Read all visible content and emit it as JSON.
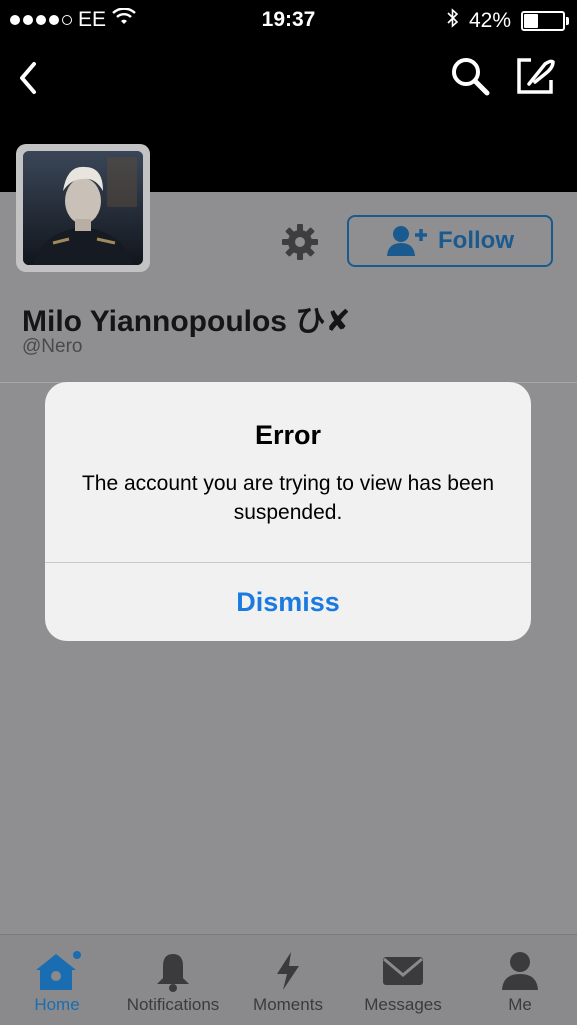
{
  "status_bar": {
    "carrier": "EE",
    "time": "19:37",
    "battery": "42%",
    "battery_level": 0.42
  },
  "navbar": {
    "back_icon": "chevron-left-icon",
    "search_icon": "search-icon",
    "compose_icon": "compose-icon"
  },
  "profile": {
    "name": "Milo Yiannopoulos ひ✘",
    "handle": "@Nero",
    "follow_label": "Follow"
  },
  "alert": {
    "title": "Error",
    "message": "The account you are trying to view has been suspended.",
    "dismiss_label": "Dismiss"
  },
  "tabs": [
    {
      "label": "Home",
      "icon": "home-icon",
      "active": true
    },
    {
      "label": "Notifications",
      "icon": "bell-icon",
      "active": false
    },
    {
      "label": "Moments",
      "icon": "lightning-icon",
      "active": false
    },
    {
      "label": "Messages",
      "icon": "envelope-icon",
      "active": false
    },
    {
      "label": "Me",
      "icon": "person-icon",
      "active": false
    }
  ],
  "colors": {
    "accent": "#1a7ae0",
    "follow_border": "#1a5a8e",
    "overlay_background": "#8f8f91"
  }
}
